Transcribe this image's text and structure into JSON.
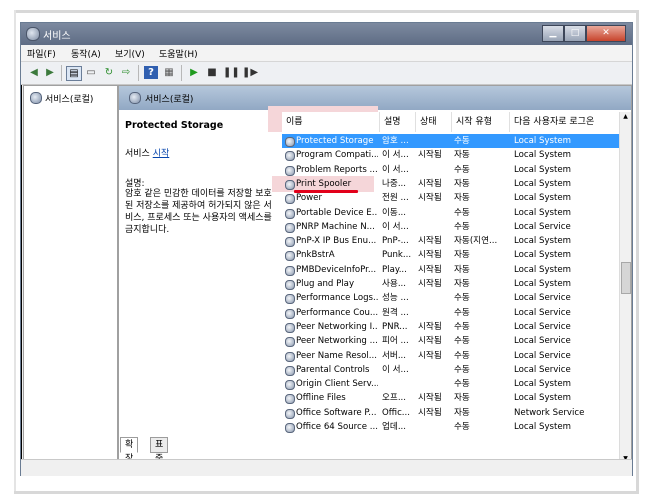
{
  "window": {
    "title": "서비스",
    "buttons": {
      "minimize": "▁",
      "maximize": "□",
      "close": "✕"
    }
  },
  "menu": [
    "파일(F)",
    "동작(A)",
    "보기(V)",
    "도움말(H)"
  ],
  "toolbar": {
    "icons": [
      "back-icon",
      "forward-icon",
      "console-tree-icon",
      "properties-icon",
      "refresh-icon",
      "export-icon",
      "help-icon",
      "view-icon",
      "start-icon",
      "stop-icon",
      "pause-icon",
      "restart-icon"
    ]
  },
  "tree": {
    "root_label": "서비스(로컬)"
  },
  "pane": {
    "header": "서비스(로컬)"
  },
  "description": {
    "title": "Protected Storage",
    "action_prefix": "서비스 ",
    "action_link": "시작",
    "label": "설명:",
    "text": "암호 같은 민감한 데이터를 저장할 보호된 저장소를 제공하여 허가되지 않은 서비스, 프로세스 또는 사용자의 액세스를 금지합니다."
  },
  "columns": [
    "이름",
    "설명",
    "상태",
    "시작 유형",
    "다음 사용자로 로그온"
  ],
  "services": [
    {
      "name": "Protected Storage",
      "desc": "암호 ...",
      "status": "",
      "startup": "수동",
      "logon": "Local System",
      "selected": true
    },
    {
      "name": "Program Compati...",
      "desc": "이 서...",
      "status": "시작됨",
      "startup": "자동",
      "logon": "Local System"
    },
    {
      "name": "Problem Reports ...",
      "desc": "이 서...",
      "status": "",
      "startup": "수동",
      "logon": "Local System"
    },
    {
      "name": "Print Spooler",
      "desc": "나중...",
      "status": "시작됨",
      "startup": "자동",
      "logon": "Local System",
      "marked": true
    },
    {
      "name": "Power",
      "desc": "전원 ...",
      "status": "시작됨",
      "startup": "자동",
      "logon": "Local System"
    },
    {
      "name": "Portable Device E...",
      "desc": "이동...",
      "status": "",
      "startup": "수동",
      "logon": "Local System"
    },
    {
      "name": "PNRP Machine N...",
      "desc": "이 서...",
      "status": "",
      "startup": "수동",
      "logon": "Local Service"
    },
    {
      "name": "PnP-X IP Bus Enu...",
      "desc": "PnP-...",
      "status": "시작됨",
      "startup": "자동(지연...",
      "logon": "Local System"
    },
    {
      "name": "PnkBstrA",
      "desc": "Punk...",
      "status": "시작됨",
      "startup": "자동",
      "logon": "Local System"
    },
    {
      "name": "PMBDeviceInfoPr...",
      "desc": "Play...",
      "status": "시작됨",
      "startup": "자동",
      "logon": "Local System"
    },
    {
      "name": "Plug and Play",
      "desc": "사용...",
      "status": "시작됨",
      "startup": "자동",
      "logon": "Local System"
    },
    {
      "name": "Performance Logs...",
      "desc": "성능 ...",
      "status": "",
      "startup": "수동",
      "logon": "Local Service"
    },
    {
      "name": "Performance Cou...",
      "desc": "원격 ...",
      "status": "",
      "startup": "수동",
      "logon": "Local Service"
    },
    {
      "name": "Peer Networking I...",
      "desc": "PNR...",
      "status": "시작됨",
      "startup": "수동",
      "logon": "Local Service"
    },
    {
      "name": "Peer Networking ...",
      "desc": "피어 ...",
      "status": "시작됨",
      "startup": "수동",
      "logon": "Local Service"
    },
    {
      "name": "Peer Name Resol...",
      "desc": "서버...",
      "status": "시작됨",
      "startup": "수동",
      "logon": "Local Service"
    },
    {
      "name": "Parental Controls",
      "desc": "이 서...",
      "status": "",
      "startup": "수동",
      "logon": "Local Service"
    },
    {
      "name": "Origin Client Serv...",
      "desc": "",
      "status": "",
      "startup": "수동",
      "logon": "Local System"
    },
    {
      "name": "Offline Files",
      "desc": "오프...",
      "status": "시작됨",
      "startup": "자동",
      "logon": "Local System"
    },
    {
      "name": "Office Software P...",
      "desc": "Offic...",
      "status": "시작됨",
      "startup": "자동",
      "logon": "Network Service"
    },
    {
      "name": "Office 64 Source ...",
      "desc": "업데...",
      "status": "",
      "startup": "수동",
      "logon": "Local System"
    }
  ],
  "tabs": [
    "확장",
    "표준"
  ],
  "colors": {
    "selection": "#3399ff",
    "highlight": "#f5d6d9",
    "underline": "#e2001a",
    "header": "#91a8c4"
  }
}
